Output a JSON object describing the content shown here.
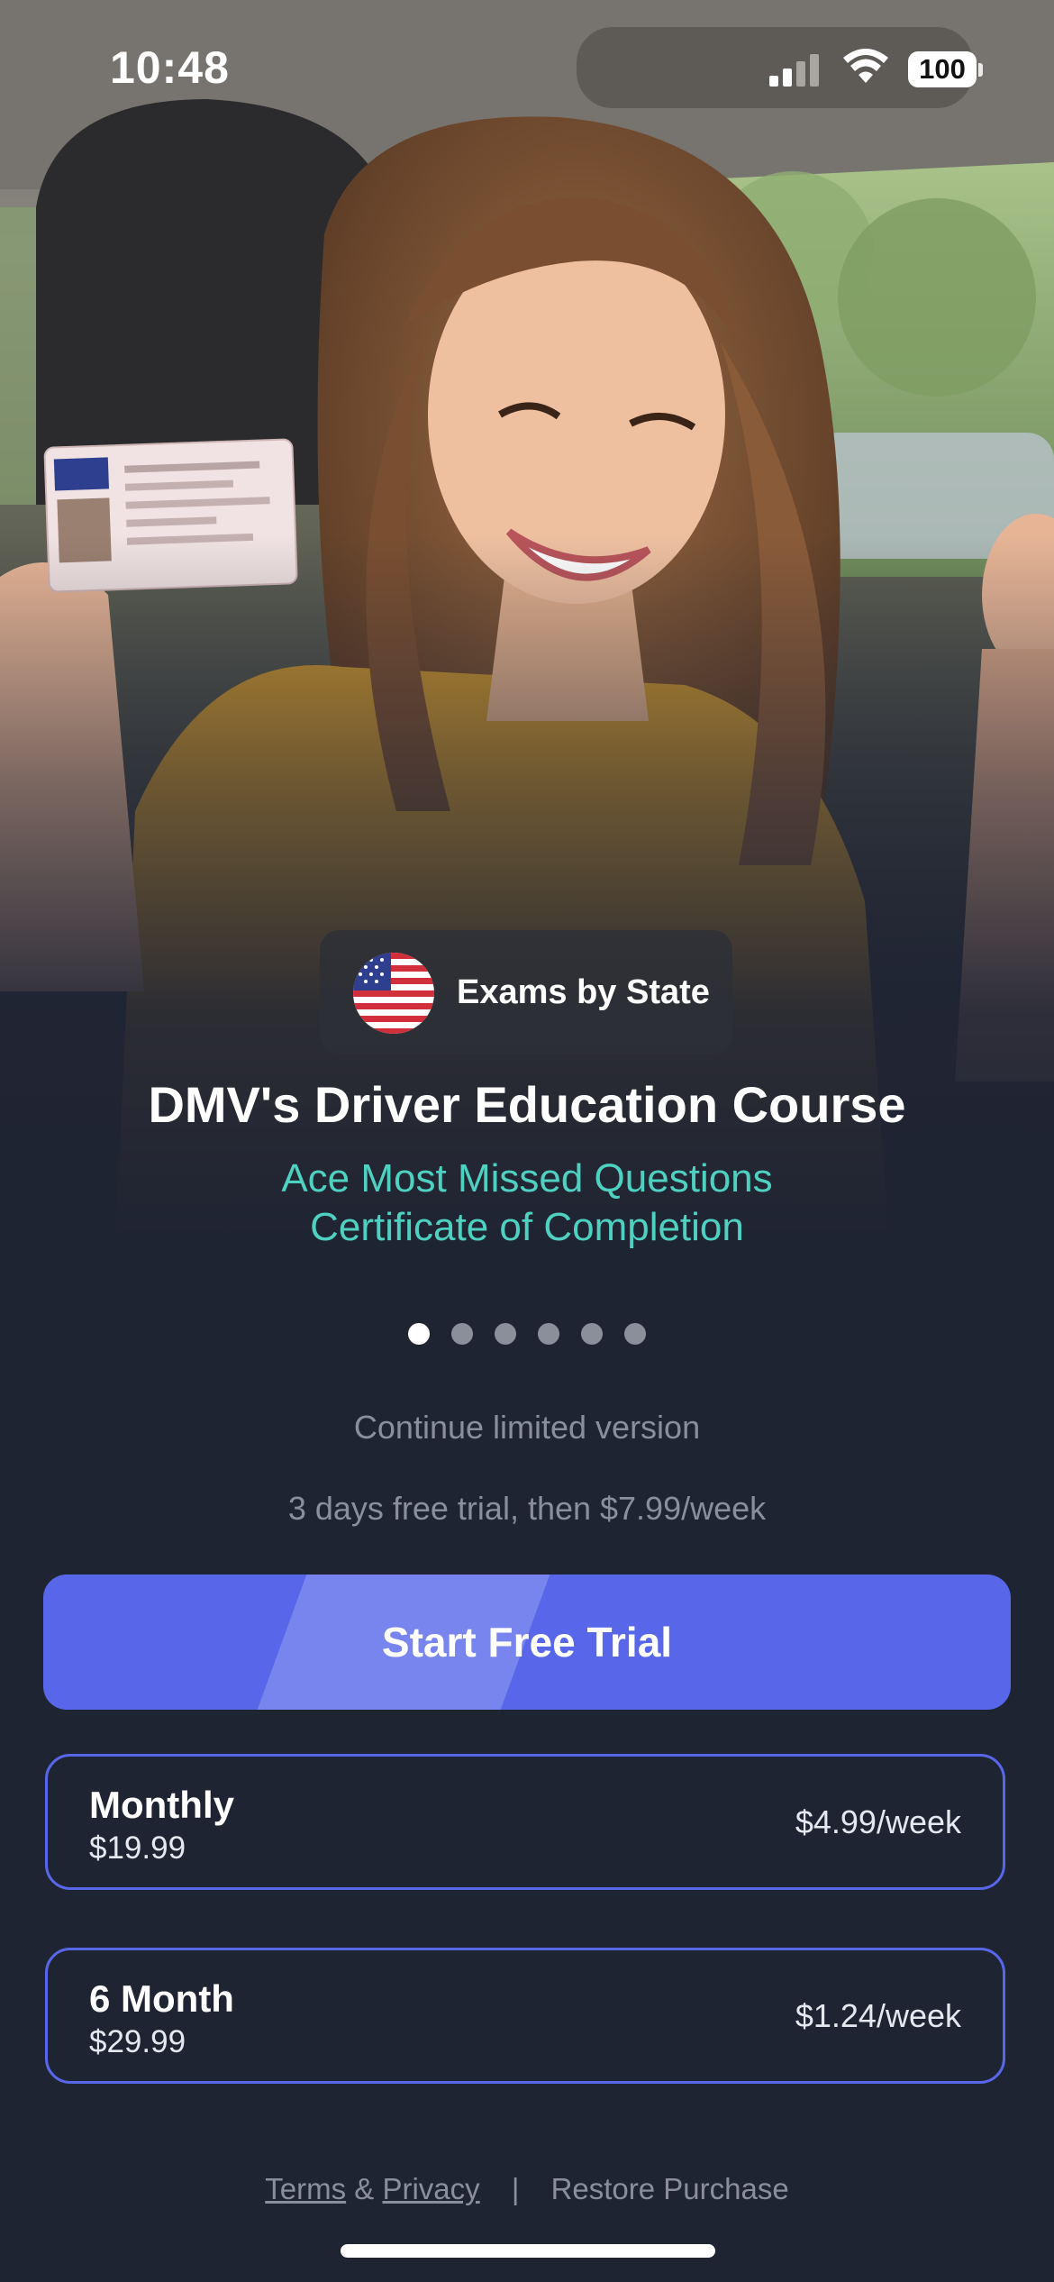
{
  "status_bar": {
    "time": "10:48",
    "battery": "100",
    "icons": [
      "signal-icon",
      "wifi-icon",
      "battery-icon"
    ]
  },
  "hero": {
    "image": "smiling woman in car holding driver license",
    "badge_icon": "us-flag-icon",
    "badge_label": "Exams by State"
  },
  "content": {
    "title": "DMV's Driver Education Course",
    "subtitle_line1": "Ace Most Missed Questions",
    "subtitle_line2": "Certificate of Completion",
    "page_indicator": {
      "count": 6,
      "active": 0
    },
    "limited_link": "Continue limited version",
    "trial_note": "3 days free trial, then $7.99/week"
  },
  "cta": {
    "label": "Start Free Trial"
  },
  "plans": [
    {
      "name": "Monthly",
      "price": "$19.99",
      "weekly": "$4.99/week"
    },
    {
      "name": "6 Month",
      "price": "$29.99",
      "weekly": "$1.24/week"
    }
  ],
  "footer": {
    "terms": "Terms",
    "amp": "&",
    "privacy": "Privacy",
    "separator": "|",
    "restore": "Restore Purchase"
  },
  "colors": {
    "background": "#1f2433",
    "accent": "#5867ea",
    "teal": "#4fd1c2",
    "muted": "#8a8f9c"
  }
}
